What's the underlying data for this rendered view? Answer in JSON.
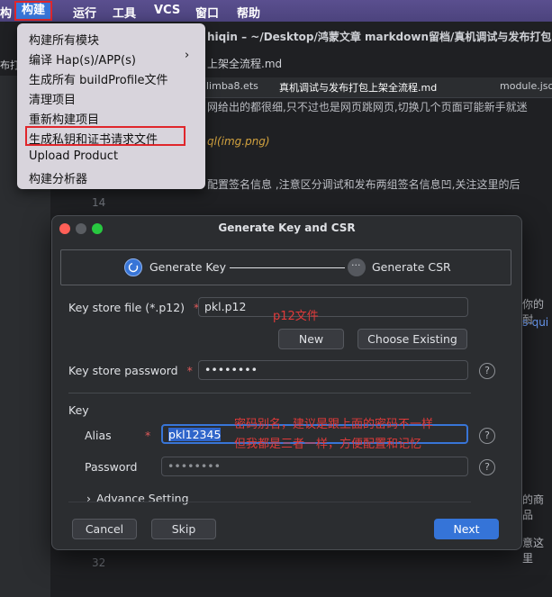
{
  "menubar": {
    "items": [
      "构",
      "构建",
      "运行",
      "工具",
      "VCS",
      "窗口",
      "帮助"
    ]
  },
  "editor": {
    "title": "hiqin – ~/Desktop/鸿蒙文章 markdown留档/真机调试与发布打包",
    "left_label": "布打",
    "breadcrumb": "上架全流程.md",
    "tabs": [
      "limba8.ets",
      "真机调试与发布打包上架全流程.md",
      "module.json"
    ],
    "lines": [
      {
        "text": "网给出的都很细,只不过也是网页跳网页,切换几个页面可能新手就迷"
      },
      {
        "text": "ql(img.png)"
      },
      {
        "text": "配置签名信息 ,注意区分调试和发布两组签名信息凹,关注这里的后"
      },
      {
        "text": "14"
      },
      {
        "text": "你的耐"
      },
      {
        "text": "s-qui"
      },
      {
        "text": "的商品"
      },
      {
        "text": "意这里"
      },
      {
        "text": "32"
      }
    ]
  },
  "build_menu": {
    "items": [
      "构建所有模块",
      "编译 Hap(s)/APP(s)",
      "生成所有 buildProfile文件",
      "清理项目",
      "重新构建项目",
      "生成私钥和证书请求文件",
      "Upload Product",
      "构建分析器"
    ]
  },
  "dialog": {
    "title": "Generate Key and CSR",
    "step1": "Generate Key",
    "step2": "Generate CSR",
    "keystore_label": "Key store file (*.p12)",
    "keystore_value": "pkl.p12",
    "new_button": "New",
    "choose_button": "Choose Existing",
    "password_label": "Key store password",
    "password_value": "••••••••",
    "key_section": "Key",
    "alias_label": "Alias",
    "alias_value": "pkl12345",
    "key_password_label": "Password",
    "key_password_value": "••••••••",
    "advance": "Advance Setting",
    "cancel": "Cancel",
    "skip": "Skip",
    "next": "Next",
    "required_mark": "*",
    "help_glyph": "?"
  },
  "annotations": {
    "p12": "p12文件",
    "alias_note_1": "密码别名，建议是跟上面的密码不一样",
    "alias_note_2": "但我都是三者一样，方便配置和记忆"
  },
  "colors": {
    "accent": "#3875d7",
    "highlight_border": "#e0262b",
    "annotation": "#e03a3a"
  }
}
